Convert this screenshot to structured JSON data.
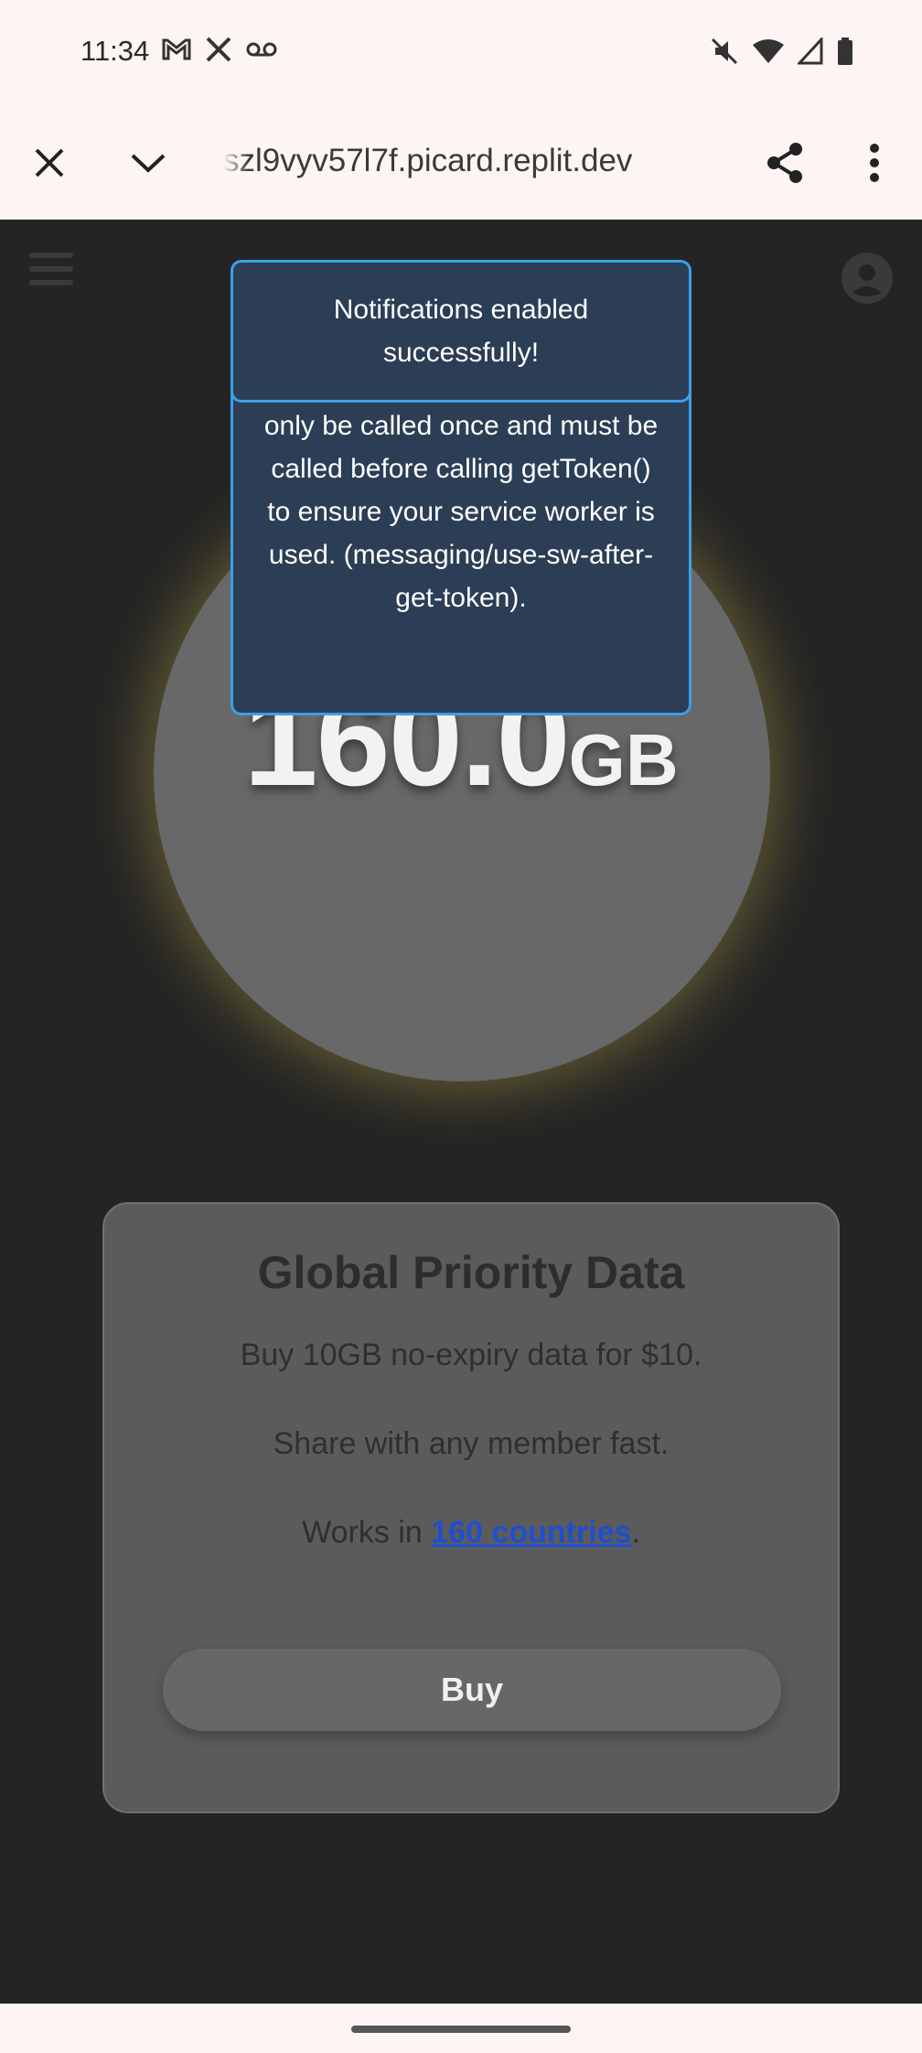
{
  "status_bar": {
    "time": "11:34",
    "left_icons": [
      "gmail-icon",
      "x-icon",
      "voicemail-icon"
    ],
    "right_icons": [
      "mute-icon",
      "wifi-icon",
      "signal-icon",
      "battery-icon"
    ]
  },
  "browser": {
    "url": "szl9vyv57l7f.picard.replit.dev",
    "close_icon": "close-icon",
    "collapse_icon": "chevron-down-icon",
    "share_icon": "share-icon",
    "menu_icon": "more-vert-icon"
  },
  "page": {
    "menu_icon": "hamburger-icon",
    "account_icon": "account-circle-icon",
    "data_amount": "160.0",
    "data_unit": "GB",
    "card": {
      "title": "Global Priority Data",
      "line1": "Buy 10GB no-expiry data for $10.",
      "line2": "Share with any member fast.",
      "line3_prefix": "Works in ",
      "line3_link": "160 countries",
      "line3_suffix": ".",
      "buy_label": "Buy"
    }
  },
  "toasts": {
    "success": "Notifications enabled successfully!",
    "error": "useServiceWorker() method may only be called once and must be called before calling getToken() to ensure your service worker is used. (messaging/use-sw-after-get-token)."
  },
  "colors": {
    "accent_border": "#3aa0e8",
    "toast_bg": "#2c3e55",
    "link": "#1f4fd1",
    "glow": "#beaa46"
  }
}
